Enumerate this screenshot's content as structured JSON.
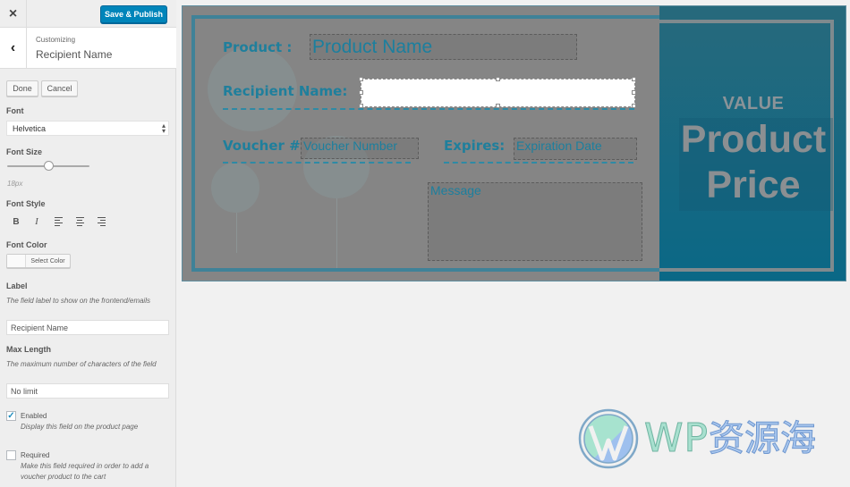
{
  "sidebar": {
    "topbar": {
      "close_icon": "×",
      "publish_label": "Save & Publish"
    },
    "header": {
      "back_icon": "‹",
      "context": "Customizing",
      "title": "Recipient Name"
    },
    "actions": {
      "done_label": "Done",
      "cancel_label": "Cancel"
    },
    "font": {
      "label": "Font",
      "selected": "Helvetica"
    },
    "font_size": {
      "label": "Font Size",
      "value": "18px",
      "slider_fraction": 0.5
    },
    "font_style": {
      "label": "Font Style",
      "bold": "B",
      "italic": "I"
    },
    "font_color": {
      "label": "Font Color",
      "button_label": "Select Color"
    },
    "label_field": {
      "label": "Label",
      "description": "The field label to show on the frontend/emails",
      "value": "Recipient Name"
    },
    "max_length": {
      "label": "Max Length",
      "description": "The maximum number of characters of the field",
      "value": "No limit"
    },
    "enabled": {
      "label": "Enabled",
      "description": "Display this field on the product page",
      "checked": true,
      "check_glyph": "✓"
    },
    "required": {
      "label": "Required",
      "description": "Make this field required in order to add a voucher product to the cart",
      "checked": false
    }
  },
  "preview": {
    "product_label": "Product :",
    "product_field": "Product Name",
    "recipient_label": "Recipient Name:",
    "recipient_field": "",
    "voucher_label": "Voucher #",
    "voucher_field": "Voucher Number",
    "expires_label": "Expires:",
    "expires_field": "Expiration Date",
    "message_field": "Message",
    "value_label": "VALUE",
    "price_line1": "Product",
    "price_line2": "Price"
  },
  "watermark": {
    "latin": "WP",
    "chinese": "资源海"
  },
  "colors": {
    "accent": "#0085ba",
    "voucher_teal": "#1f7f9c",
    "panel_teal": "#0a6886"
  }
}
